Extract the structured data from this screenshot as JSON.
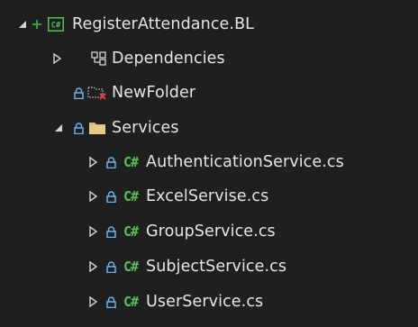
{
  "colors": {
    "background": "#1f1f1f",
    "text": "#e6e6e6",
    "csharp_green": "#55c255",
    "lock_blue": "#6cb3f0",
    "folder_tan": "#dcb67a"
  },
  "tree": {
    "project": {
      "label": "RegisterAttendance.BL",
      "icon": "csharp-project-icon",
      "status_icon": "plus-icon",
      "expanded": true
    },
    "dependencies": {
      "label": "Dependencies",
      "icon": "dependencies-icon",
      "expanded": false
    },
    "new_folder": {
      "label": "NewFolder",
      "icon": "missing-folder-icon",
      "status_icon": "lock-icon"
    },
    "services": {
      "label": "Services",
      "icon": "folder-icon",
      "status_icon": "lock-icon",
      "expanded": true,
      "files": [
        {
          "label": "AuthenticationService.cs",
          "icon": "csharp-file-icon",
          "status_icon": "lock-icon"
        },
        {
          "label": "ExcelServise.cs",
          "icon": "csharp-file-icon",
          "status_icon": "lock-icon"
        },
        {
          "label": "GroupService.cs",
          "icon": "csharp-file-icon",
          "status_icon": "lock-icon"
        },
        {
          "label": "SubjectService.cs",
          "icon": "csharp-file-icon",
          "status_icon": "lock-icon"
        },
        {
          "label": "UserService.cs",
          "icon": "csharp-file-icon",
          "status_icon": "lock-icon"
        }
      ]
    }
  }
}
